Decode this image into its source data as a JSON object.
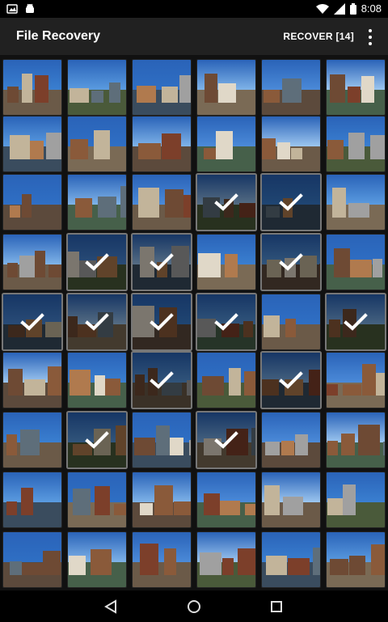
{
  "status": {
    "time": "8:08"
  },
  "app_bar": {
    "title": "File Recovery",
    "recover_label": "RECOVER [14]"
  },
  "grid": {
    "columns": 6,
    "rows": [
      {
        "selected": [
          false,
          false,
          false,
          false,
          false,
          false
        ]
      },
      {
        "selected": [
          false,
          false,
          false,
          false,
          false,
          false
        ]
      },
      {
        "selected": [
          false,
          false,
          false,
          true,
          true,
          false
        ]
      },
      {
        "selected": [
          false,
          true,
          true,
          false,
          true,
          false
        ]
      },
      {
        "selected": [
          true,
          true,
          true,
          true,
          false,
          true
        ]
      },
      {
        "selected": [
          false,
          false,
          true,
          false,
          true,
          false
        ]
      },
      {
        "selected": [
          false,
          true,
          false,
          true,
          false,
          false
        ]
      },
      {
        "selected": [
          false,
          false,
          false,
          false,
          false,
          false
        ]
      },
      {
        "selected": [
          false,
          false,
          false,
          false,
          false,
          false
        ]
      }
    ]
  },
  "nav": {
    "back_icon": "back-icon",
    "home_icon": "home-icon",
    "recents_icon": "recents-icon"
  }
}
